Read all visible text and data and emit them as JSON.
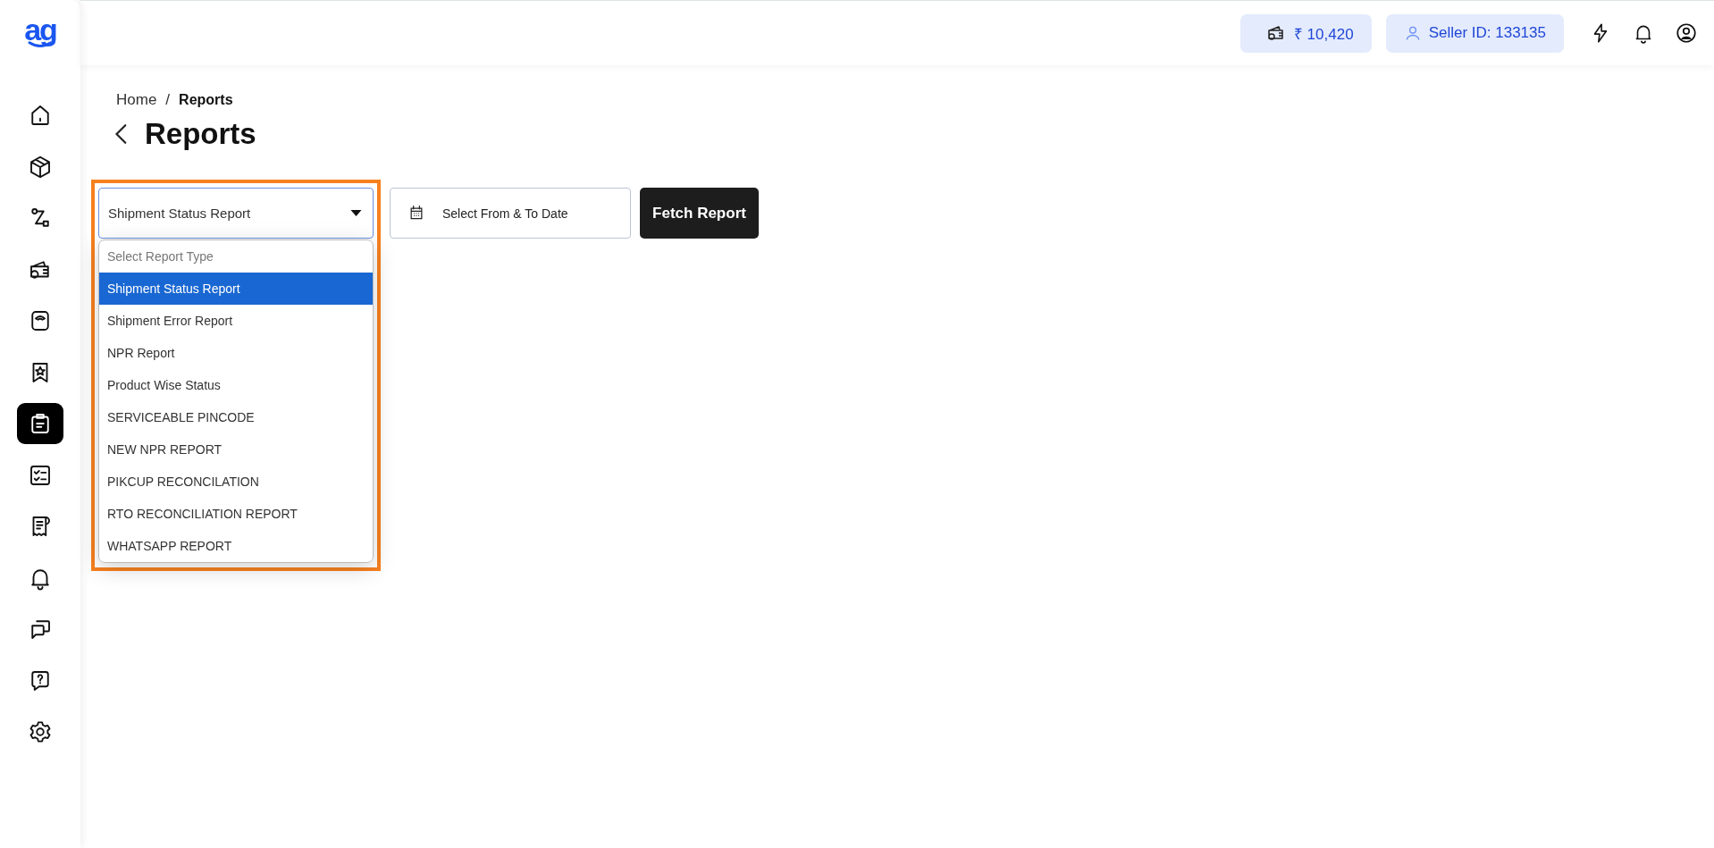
{
  "logo": {
    "text": "ag"
  },
  "sidebar": {
    "items": [
      {
        "selected": false
      },
      {
        "selected": false
      },
      {
        "selected": false
      },
      {
        "selected": false
      },
      {
        "selected": false
      },
      {
        "selected": false
      },
      {
        "selected": true
      },
      {
        "selected": false
      },
      {
        "selected": false
      },
      {
        "selected": false
      },
      {
        "selected": false
      },
      {
        "selected": false
      },
      {
        "selected": false
      }
    ]
  },
  "topbar": {
    "wallet_balance": "₹ 10,420",
    "seller_id": "Seller ID: 133135"
  },
  "breadcrumb": [
    {
      "label": "Home",
      "current": false
    },
    {
      "label": "Reports",
      "current": true
    }
  ],
  "breadcrumb_separator": "/",
  "page_title": "Reports",
  "report_select": {
    "value": "Shipment Status Report",
    "expanded": true,
    "highlighted": true,
    "options": [
      {
        "label": "Select Report Type",
        "kind": "placeholder",
        "selected": false
      },
      {
        "label": "Shipment Status Report",
        "kind": "option",
        "selected": true
      },
      {
        "label": "Shipment Error Report",
        "kind": "option",
        "selected": false
      },
      {
        "label": "NPR Report",
        "kind": "option",
        "selected": false
      },
      {
        "label": "Product Wise Status",
        "kind": "option",
        "selected": false
      },
      {
        "label": "SERVICEABLE PINCODE",
        "kind": "option",
        "selected": false
      },
      {
        "label": "NEW NPR REPORT",
        "kind": "option",
        "selected": false
      },
      {
        "label": "PIKCUP RECONCILATION",
        "kind": "option",
        "selected": false
      },
      {
        "label": "RTO RECONCILIATION REPORT",
        "kind": "option",
        "selected": false
      },
      {
        "label": "WHATSAPP REPORT",
        "kind": "option",
        "selected": false
      }
    ]
  },
  "date_field": {
    "placeholder": "Select From & To Date"
  },
  "fetch_button": "Fetch Report"
}
